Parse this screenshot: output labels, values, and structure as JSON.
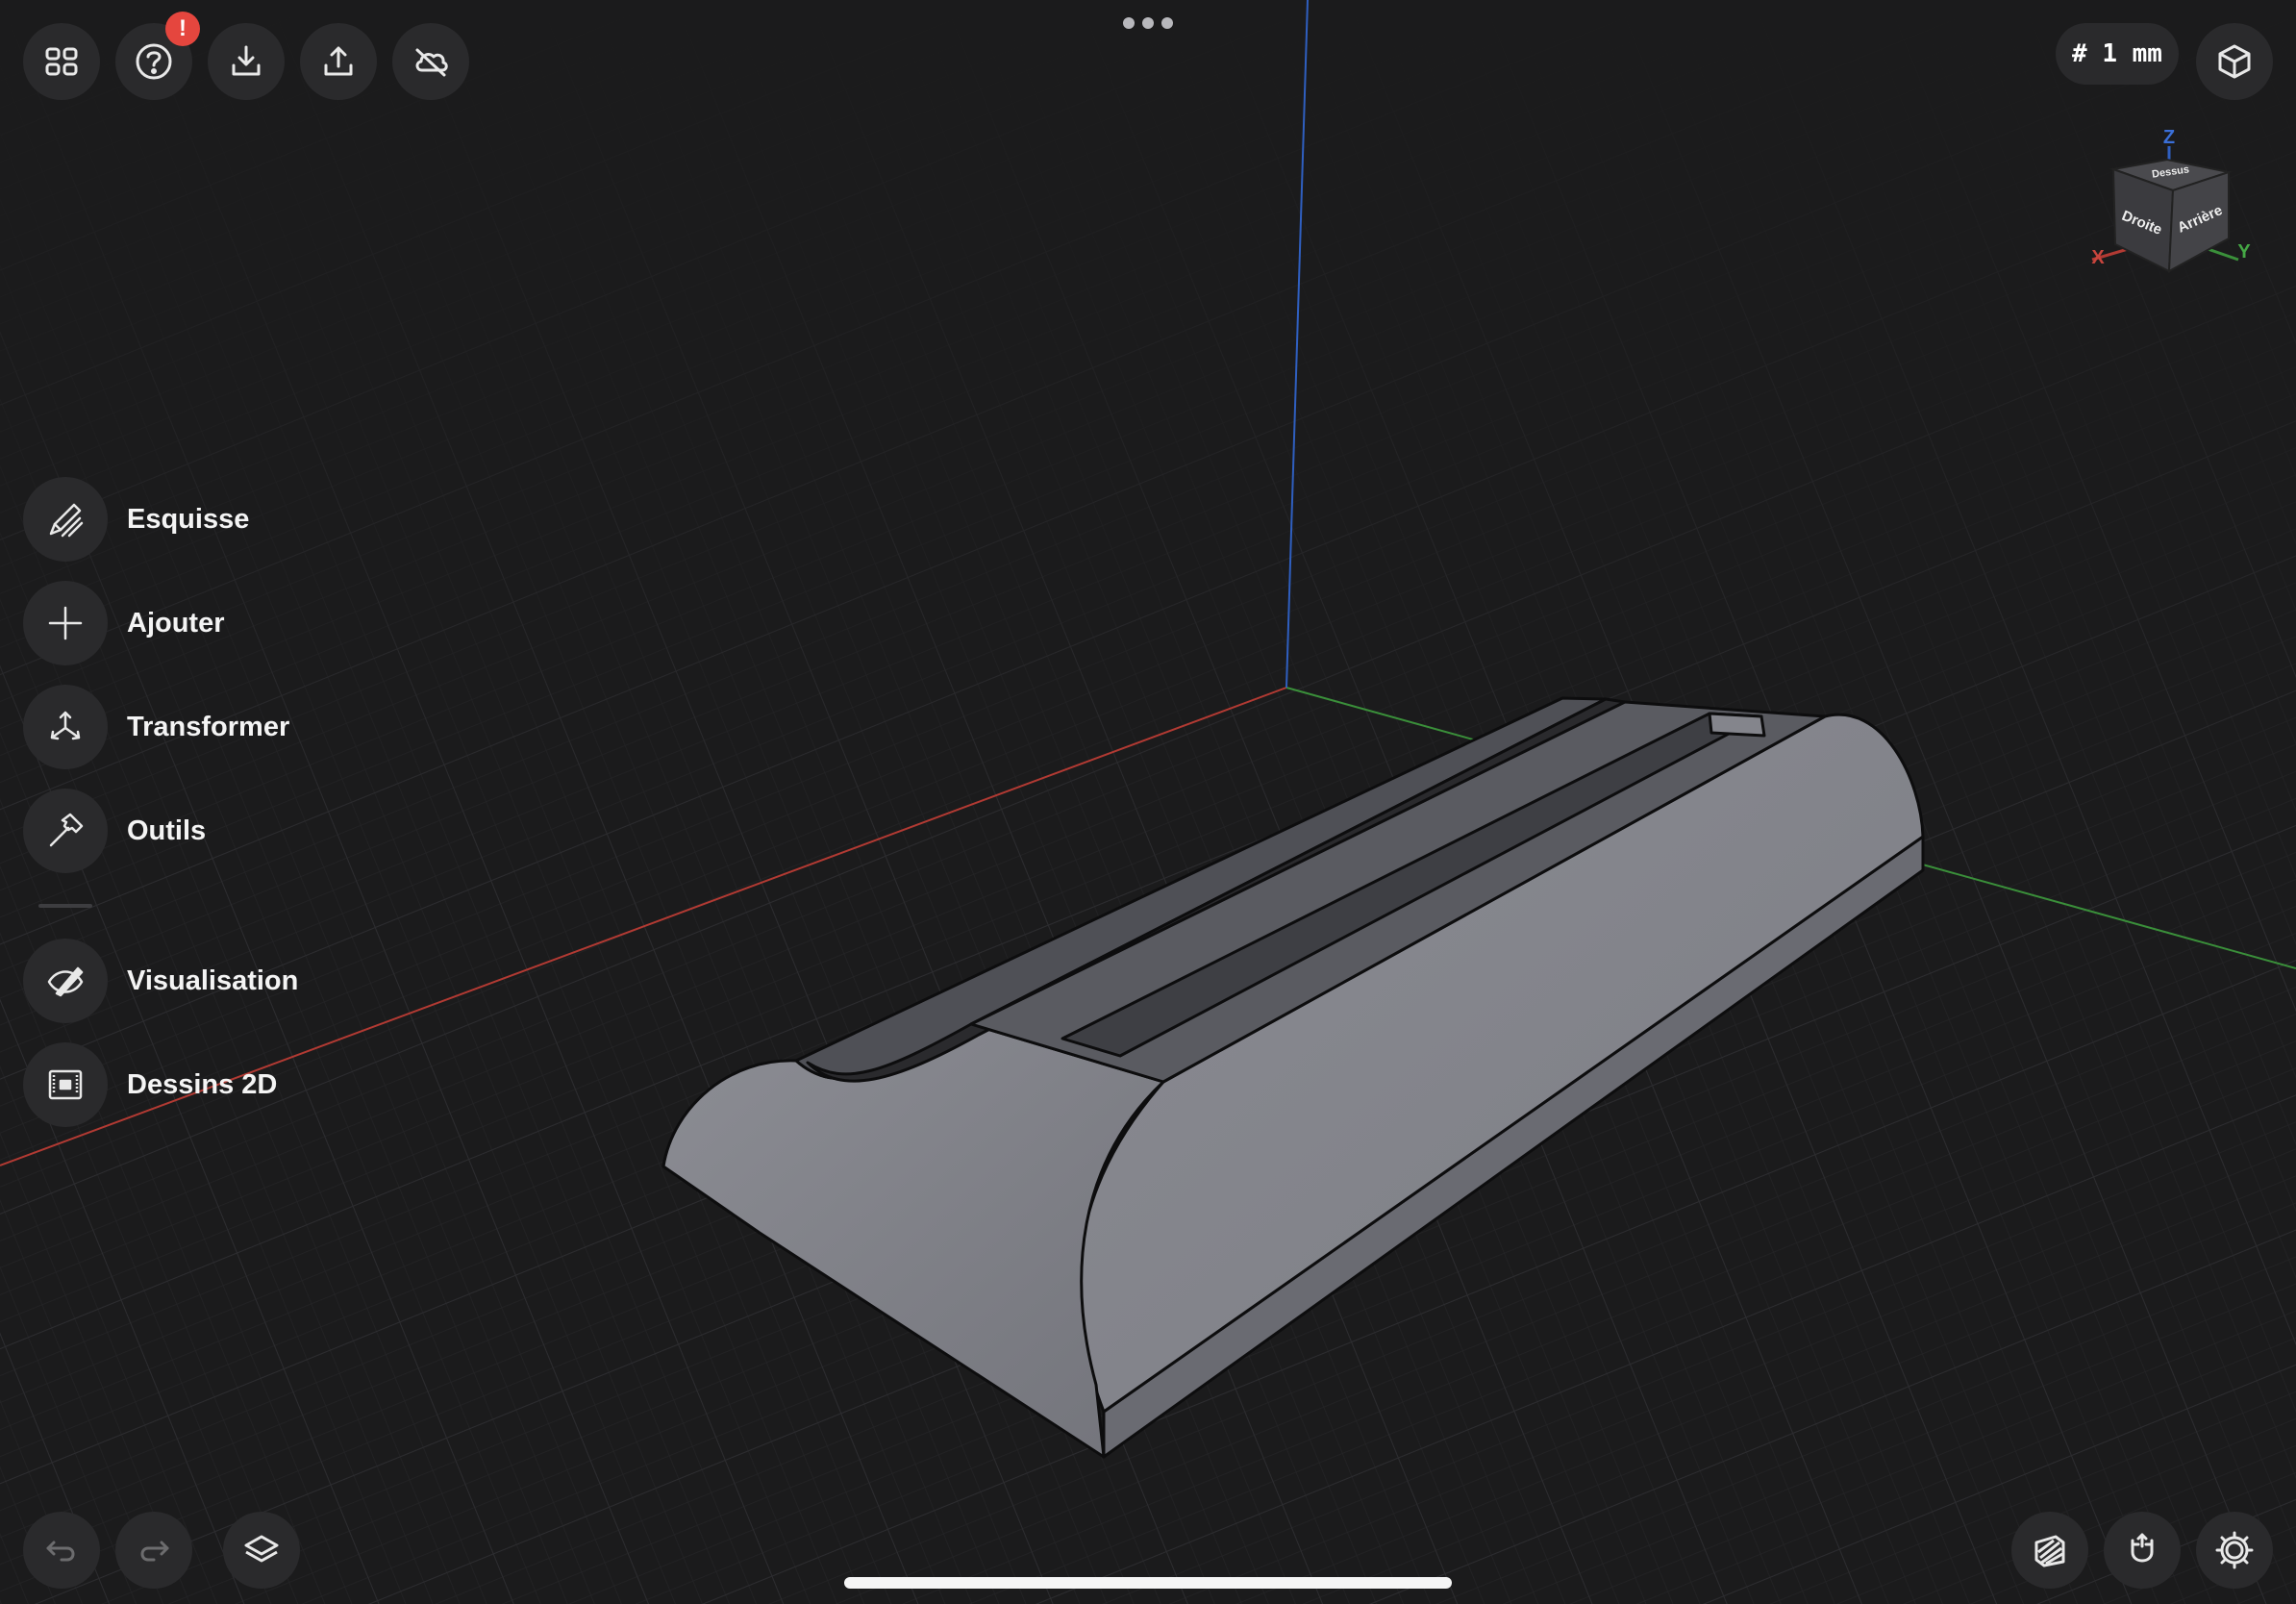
{
  "toolbar": {
    "notification_badge": "!",
    "grid_unit": "# 1 mm"
  },
  "side_menu": {
    "items": [
      {
        "label": "Esquisse",
        "icon": "sketch-pencil-icon"
      },
      {
        "label": "Ajouter",
        "icon": "plus-icon"
      },
      {
        "label": "Transformer",
        "icon": "transform-arrows-icon"
      },
      {
        "label": "Outils",
        "icon": "hammer-icon"
      },
      {
        "label": "Visualisation",
        "icon": "visualization-brush-icon"
      },
      {
        "label": "Dessins 2D",
        "icon": "drawing-2d-icon"
      }
    ]
  },
  "view_cube": {
    "faces": {
      "top": "Dessus",
      "left": "Droite",
      "right": "Arrière"
    },
    "axes": {
      "x": "X",
      "y": "Y",
      "z": "Z"
    }
  },
  "colors": {
    "background": "#1b1b1c",
    "button_bg": "#2a2a2c",
    "badge": "#e5463e",
    "axis_x": "#b23a33",
    "axis_y": "#3a8f3a",
    "axis_z": "#2f5fc0",
    "model_face": "#84858c",
    "model_top": "#6e6f76",
    "model_slot": "#4a4b50"
  }
}
